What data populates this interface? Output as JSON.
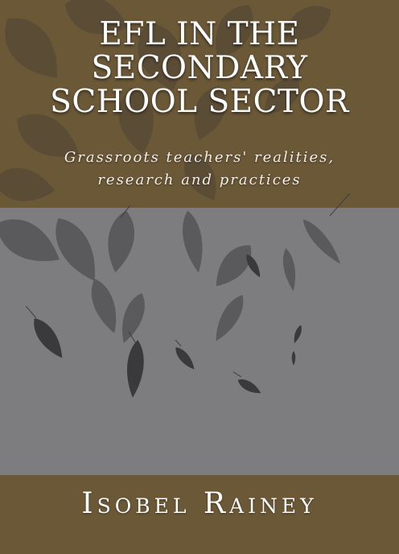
{
  "cover": {
    "title_lines": [
      "EFL IN THE",
      "SECONDARY",
      "SCHOOL SECTOR"
    ],
    "subtitle_lines": [
      "Grassroots teachers' realities,",
      "research and practices"
    ],
    "author": "Isobel Rainey"
  },
  "colors": {
    "brown_band": "#6b5837",
    "grey_band": "#7d7d80",
    "leaf_dark": "#3a3a3c",
    "title_text": "#ffffff"
  },
  "illustration": {
    "leaves_icon": "falling-leaves-icon"
  }
}
